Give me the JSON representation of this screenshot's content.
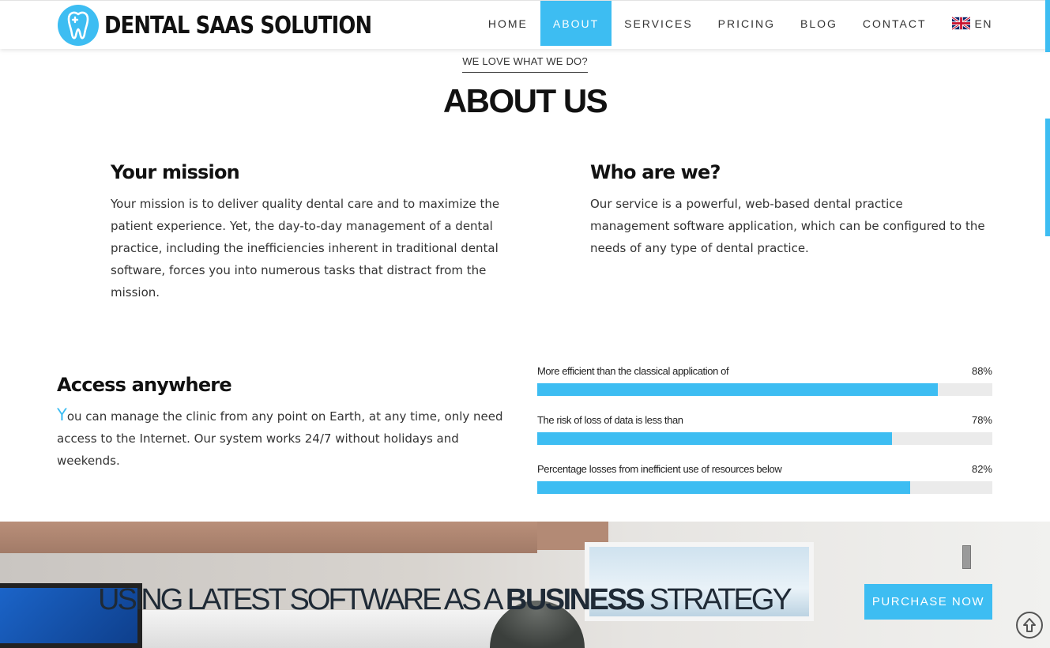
{
  "header": {
    "brand": "DENTAL SAAS SOLUTION",
    "nav": [
      {
        "label": "HOME",
        "active": false
      },
      {
        "label": "ABOUT",
        "active": true
      },
      {
        "label": "SERVICES",
        "active": false
      },
      {
        "label": "PRICING",
        "active": false
      },
      {
        "label": "BLOG",
        "active": false
      },
      {
        "label": "CONTACT",
        "active": false
      }
    ],
    "language": "EN"
  },
  "about": {
    "eyebrow": "WE LOVE WHAT WE DO?",
    "title": "ABOUT US",
    "mission": {
      "heading": "Your mission",
      "text": "Your mission is to deliver quality dental care and to maximize the patient experience. Yet, the day-to-day management of a dental practice, including the inefficiencies inherent in traditional dental software, forces you into numerous tasks that distract from the mission."
    },
    "who": {
      "heading": "Who are we?",
      "text": "Our service is a powerful, web-based dental practice management software application, which can be configured to the needs of any type of dental practice."
    },
    "access": {
      "heading": "Access anywhere",
      "dropcap": "Y",
      "text": "ou can manage the clinic from any point on Earth, at any time, only need access to the Internet. Our system works 24/7 without holidays and weekends."
    }
  },
  "progress": [
    {
      "label": "More efficient than the classical application of",
      "value": "88%",
      "percent": 88
    },
    {
      "label": "The risk of loss of data is less than",
      "value": "78%",
      "percent": 78
    },
    {
      "label": "Percentage losses from inefficient use of resources below",
      "value": "82%",
      "percent": 82
    }
  ],
  "banner": {
    "title_prefix": "USING LATEST SOFTWARE AS A ",
    "title_bold": "BUSINESS",
    "title_suffix": " STRATEGY",
    "cta": "PURCHASE NOW"
  },
  "colors": {
    "accent": "#3dbdf2",
    "track": "#ebebeb",
    "text": "#333333"
  },
  "icons": {
    "logo": "tooth-plus-icon",
    "flag": "uk-flag-icon",
    "back_to_top": "arrow-up-circle-icon"
  }
}
